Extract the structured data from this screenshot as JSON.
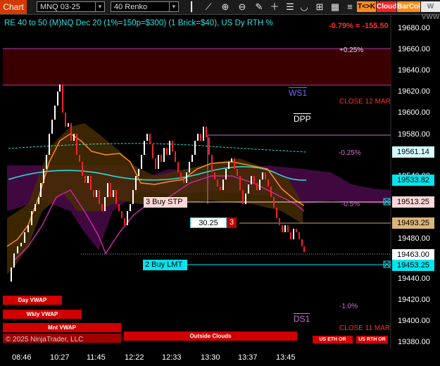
{
  "toolbar": {
    "chart_tab": "Chart",
    "instrument": "MNQ 03-25",
    "bar_type": "40 Renko",
    "icons": [
      "bar-style-icon",
      "drawing-tools-icon",
      "pencil-icon",
      "zoom-in-icon",
      "zoom-out-icon",
      "magnet-icon",
      "add-icon",
      "scale-icon",
      "list-icon",
      "menu-icon"
    ],
    "tck_label": "T<>K",
    "cloud_label": "Cloud",
    "barcol_label": "BarCol",
    "w_label": "W VWW"
  },
  "header": {
    "title": "RE 40 to 50 (M)NQ Dec 20 (1%=150p=$300) (1 Brick=$40), US Dy RTH %",
    "change": "-0.79% = -155.50"
  },
  "annotations": {
    "plus_025": "+0.25%",
    "ws1": "WS1",
    "close_12mar": "CLOSE 12 MAR",
    "dpp": "DPP",
    "minus_025": "-0.25%",
    "minus_05": "-0.5%",
    "minus_1": "-1.0%",
    "ds1": "DS1",
    "close_11mar": "CLOSE 11 MAR"
  },
  "orders": {
    "buy_stp": "3 Buy STP",
    "price_tag": "30.25",
    "qty": "3",
    "buy_lmt": "2 Buy LMT"
  },
  "price_axis": {
    "ticks": [
      "19680.00",
      "19660.00",
      "19640.00",
      "19620.00",
      "19600.00",
      "19580.00",
      "19540.00",
      "19480.00",
      "19440.00",
      "19420.00",
      "19400.00",
      "19380.00"
    ],
    "boxes": [
      "19561.14",
      "19533.82",
      "19513.25",
      "19493.25",
      "19463.00",
      "19453.25"
    ]
  },
  "time_axis": [
    "08:46",
    "10:27",
    "11:45",
    "12:22",
    "12:33",
    "13:30",
    "13:37",
    "13:45"
  ],
  "bottom_buttons": {
    "day_vwap": "Day VWAP",
    "wkly_vwap": "Wkly VWAP",
    "mnt_vwap": "Mnt VWAP",
    "outside_clouds": "Outside Clouds",
    "us_eth_or": "US ETH OR",
    "us_rth_or": "US RTH OR",
    "copyright": "© 2025 NinjaTrader, LLC"
  },
  "colors": {
    "accent_orange": "#d43a00",
    "cyan": "#00e5ee",
    "sell_red": "#d00000",
    "cloud_red": "#3a0000",
    "cloud_magenta": "#4a0a4a",
    "cloud_orange": "#5a3a00"
  }
}
